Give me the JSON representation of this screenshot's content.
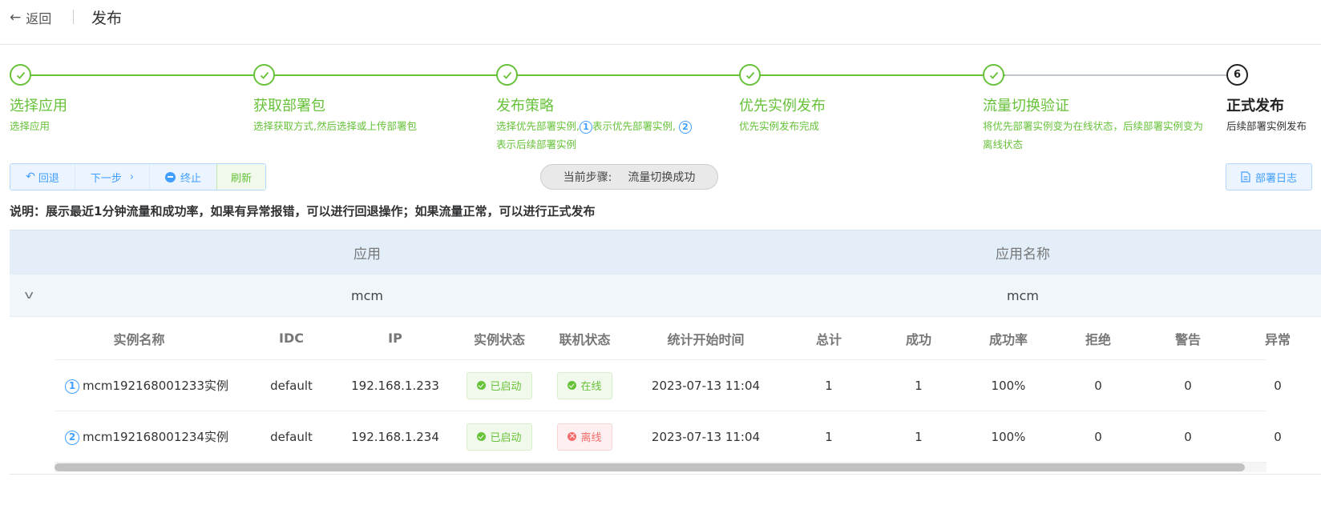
{
  "header": {
    "back_label": "返回",
    "title": "发布"
  },
  "steps": [
    {
      "title": "选择应用",
      "desc": "选择应用"
    },
    {
      "title": "获取部署包",
      "desc": "选择获取方式,然后选择或上传部署包"
    },
    {
      "title": "发布策略",
      "desc_a": "选择优先部署实例,",
      "num1": "1",
      "desc_b": "表示优先部署实例,",
      "num2": "2",
      "desc_c": "表示后续部署实例"
    },
    {
      "title": "优先实例发布",
      "desc": "优先实例发布完成"
    },
    {
      "title": "流量切换验证",
      "desc": "将优先部署实例变为在线状态，后续部署实例变为离线状态"
    },
    {
      "title": "正式发布",
      "desc": "后续部署实例发布",
      "number": "6"
    }
  ],
  "toolbar": {
    "rollback": "回退",
    "next": "下一步",
    "stop": "终止",
    "refresh": "刷新",
    "current_label": "当前步骤:",
    "current_value": "流量切换成功",
    "log": "部署日志"
  },
  "note": "说明：展示最近1分钟流量和成功率，如果有异常报错，可以进行回退操作；如果流量正常，可以进行正式发布",
  "outer_table": {
    "headers": [
      "应用",
      "应用名称"
    ],
    "row": [
      "mcm",
      "mcm"
    ]
  },
  "inner_table": {
    "headers": [
      "实例名称",
      "IDC",
      "IP",
      "实例状态",
      "联机状态",
      "统计开始时间",
      "总计",
      "成功",
      "成功率",
      "拒绝",
      "警告",
      "异常"
    ],
    "rows": [
      {
        "num": "1",
        "name": "mcm192168001233实例",
        "idc": "default",
        "ip": "192.168.1.233",
        "status": "已启动",
        "online": "在线",
        "start": "2023-07-13 11:04",
        "total": "1",
        "success": "1",
        "rate": "100%",
        "reject": "0",
        "warn": "0",
        "error": "0"
      },
      {
        "num": "2",
        "name": "mcm192168001234实例",
        "idc": "default",
        "ip": "192.168.1.234",
        "status": "已启动",
        "online": "离线",
        "start": "2023-07-13 11:04",
        "total": "1",
        "success": "1",
        "rate": "100%",
        "reject": "0",
        "warn": "0",
        "error": "0"
      }
    ]
  },
  "colors": {
    "success": "#67c23a",
    "primary": "#409eff",
    "danger": "#f56c6c"
  }
}
